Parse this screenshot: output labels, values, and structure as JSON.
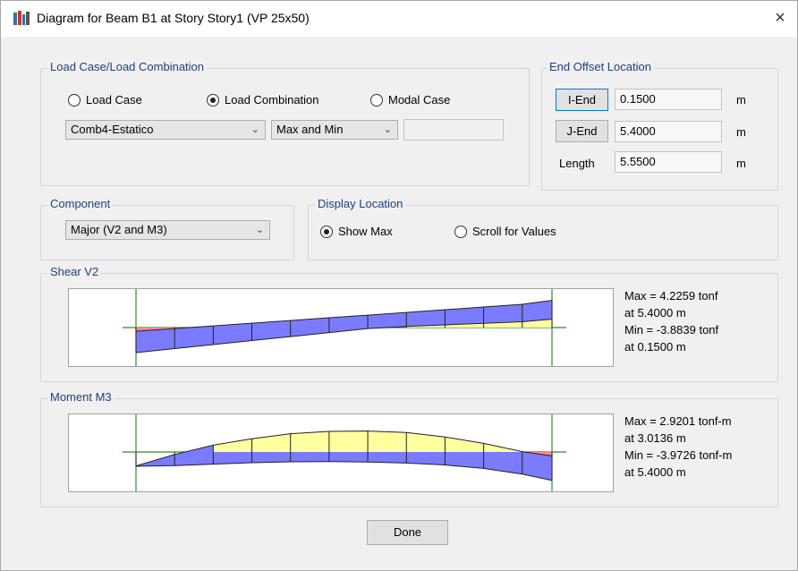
{
  "window": {
    "title": "Diagram for Beam B1 at Story Story1 (VP 25x50)",
    "close_glyph": "×"
  },
  "load_case_group": {
    "title": "Load Case/Load Combination",
    "radios": [
      {
        "label": "Load Case",
        "selected": false
      },
      {
        "label": "Load Combination",
        "selected": true
      },
      {
        "label": "Modal Case",
        "selected": false
      }
    ],
    "combo_value": "Comb4-Estatico",
    "envelope_value": "Max and Min",
    "extra_field_value": ""
  },
  "end_offset_group": {
    "title": "End Offset Location",
    "i_end_label": "I-End",
    "i_end_value": "0.1500",
    "j_end_label": "J-End",
    "j_end_value": "5.4000",
    "length_label": "Length",
    "length_value": "5.5500",
    "unit": "m"
  },
  "component_group": {
    "title": "Component",
    "value": "Major (V2 and M3)"
  },
  "display_group": {
    "title": "Display Location",
    "radios": [
      {
        "label": "Show Max",
        "selected": true
      },
      {
        "label": "Scroll for Values",
        "selected": false
      }
    ]
  },
  "shear_group": {
    "title": "Shear V2",
    "max_text": "Max = 4.2259 tonf",
    "max_at": "at 5.4000 m",
    "min_text": "Min = -3.8839 tonf",
    "min_at": "at 0.1500 m"
  },
  "moment_group": {
    "title": "Moment M3",
    "max_text": "Max = 2.9201 tonf-m",
    "max_at": "at 3.0136 m",
    "min_text": "Min = -3.9726 tonf-m",
    "min_at": "at 5.4000 m"
  },
  "done_label": "Done",
  "colors": {
    "group_title": "#1e3f7e",
    "envelope_blue": "#7b7bff",
    "envelope_yellow": "#ffff9e",
    "envelope_red": "#ff8a8a",
    "baseline_green": "#2e8b2e",
    "focus_border": "#0078d7"
  },
  "chart_data": [
    {
      "type": "area",
      "title": "Shear V2",
      "x": [
        0.15,
        0.6375,
        1.125,
        1.6125,
        2.1,
        2.5875,
        3.075,
        3.5625,
        4.05,
        4.5375,
        5.025,
        5.4
      ],
      "series": [
        {
          "name": "Max",
          "values": [
            -0.58,
            -0.16,
            0.26,
            0.68,
            1.1,
            1.52,
            1.93,
            2.35,
            2.77,
            3.19,
            3.61,
            4.2259
          ]
        },
        {
          "name": "Min",
          "values": [
            -3.8839,
            -3.26,
            -2.64,
            -2.02,
            -1.4,
            -0.78,
            -0.16,
            0.18,
            0.42,
            0.66,
            0.9,
            1.3
          ]
        }
      ],
      "xlim": [
        0.15,
        5.4
      ]
    },
    {
      "type": "area",
      "title": "Moment M3",
      "x": [
        0.15,
        0.6375,
        1.125,
        1.6125,
        2.1,
        2.5875,
        3.075,
        3.5625,
        4.05,
        4.5375,
        5.025,
        5.4
      ],
      "series": [
        {
          "name": "Max",
          "values": [
            -1.95,
            -0.35,
            0.95,
            1.85,
            2.55,
            2.88,
            2.9201,
            2.72,
            2.1,
            1.2,
            0.05,
            -0.55
          ]
        },
        {
          "name": "Min",
          "values": [
            -2.0,
            -1.9,
            -1.7,
            -1.5,
            -1.38,
            -1.35,
            -1.4,
            -1.55,
            -1.82,
            -2.3,
            -3.1,
            -3.9726
          ]
        }
      ],
      "xlim": [
        0.15,
        5.4
      ]
    }
  ]
}
